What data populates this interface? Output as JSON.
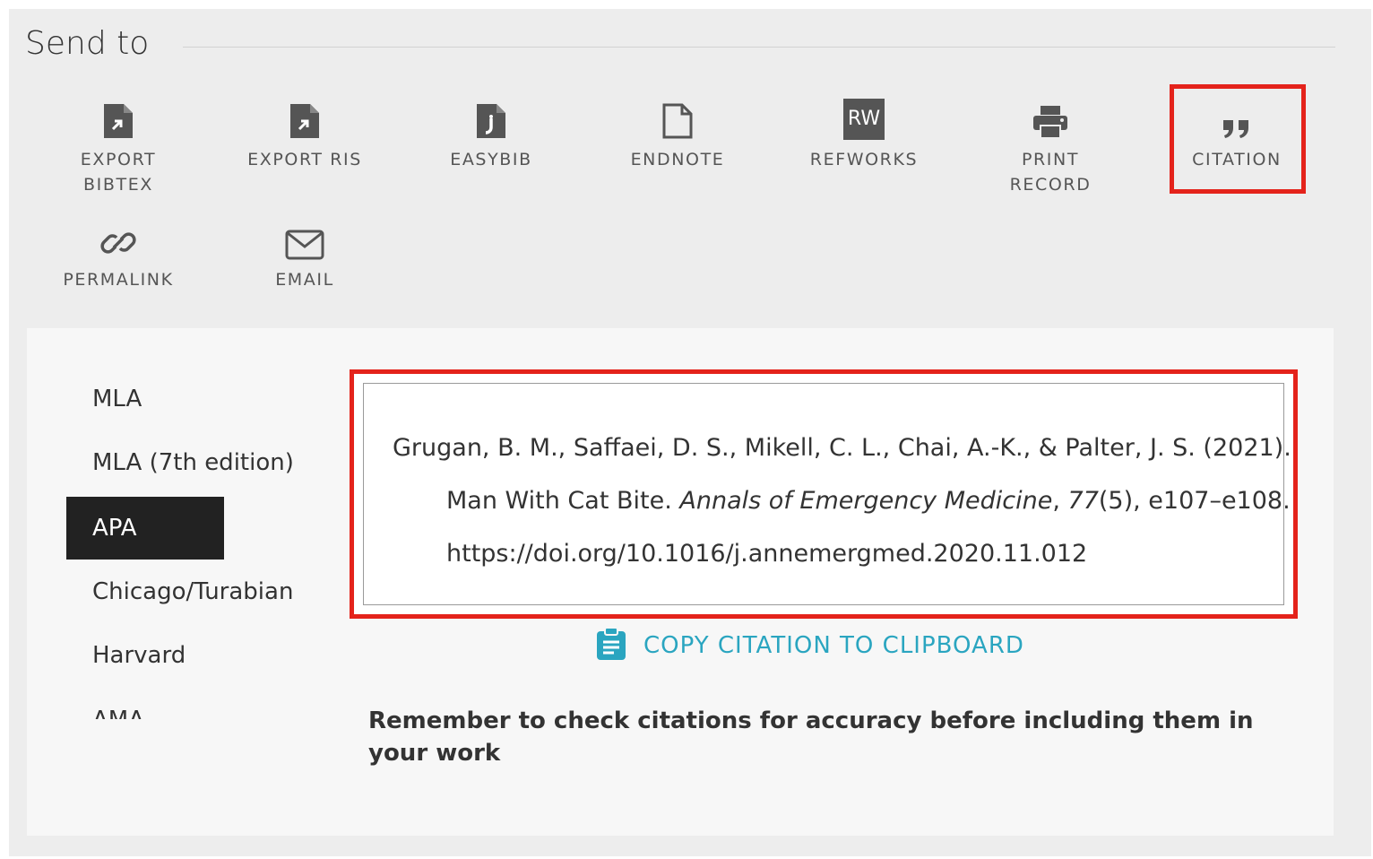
{
  "header": {
    "title": "Send to"
  },
  "actions": [
    {
      "label": "EXPORT BIBTEX",
      "icon": "file-export-icon"
    },
    {
      "label": "EXPORT RIS",
      "icon": "file-export-icon"
    },
    {
      "label": "EASYBIB",
      "icon": "easybib-file-icon"
    },
    {
      "label": "ENDNOTE",
      "icon": "file-outline-icon"
    },
    {
      "label": "REFWORKS",
      "icon": "refworks-icon",
      "icon_text": "RW"
    },
    {
      "label": "PRINT RECORD",
      "icon": "printer-icon"
    },
    {
      "label": "CITATION",
      "icon": "quote-icon",
      "highlighted": true
    },
    {
      "label": "PERMALINK",
      "icon": "link-icon"
    },
    {
      "label": "EMAIL",
      "icon": "envelope-icon"
    }
  ],
  "citation_styles": [
    {
      "label": "MLA"
    },
    {
      "label": "MLA (7th edition)"
    },
    {
      "label": "APA",
      "selected": true
    },
    {
      "label": "Chicago/Turabian"
    },
    {
      "label": "Harvard"
    },
    {
      "label": "AMA"
    }
  ],
  "citation": {
    "authors_year": "Grugan, B. M., Saffaei, D. S., Mikell, C. L., Chai, A.-K., & Palter, J. S. (2021). Man With Cat Bite. ",
    "journal": "Annals of Emergency Medicine",
    "sep1": ", ",
    "volume": "77",
    "issue_pages_doi": "(5), e107–e108. https://doi.org/10.1016/j.annemergmed.2020.11.012"
  },
  "copy_button": {
    "label": "COPY CITATION TO CLIPBOARD",
    "icon": "clipboard-icon"
  },
  "reminder": "Remember to check citations for accuracy before including them in your work",
  "colors": {
    "highlight": "#e4231b",
    "link": "#2aa5c0",
    "active_bg": "#222222"
  }
}
